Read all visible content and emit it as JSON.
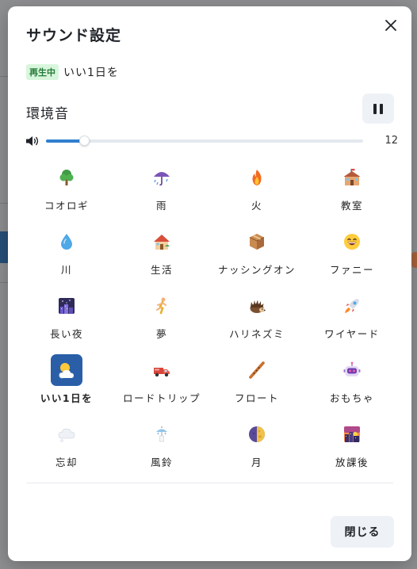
{
  "dialog": {
    "title": "サウンド設定",
    "close_icon": "close-icon"
  },
  "now_playing": {
    "badge": "再生中",
    "title": "いい1日を"
  },
  "ambient": {
    "section_title": "環境音",
    "pause_icon": "pause-icon",
    "volume_icon": "speaker-icon",
    "volume_value": "12",
    "volume_fraction": 0.12
  },
  "sounds": [
    {
      "label": "コオロギ",
      "icon": "tree-icon"
    },
    {
      "label": "雨",
      "icon": "umbrella-rain-icon"
    },
    {
      "label": "火",
      "icon": "fire-icon"
    },
    {
      "label": "教室",
      "icon": "school-icon"
    },
    {
      "label": "川",
      "icon": "droplet-icon"
    },
    {
      "label": "生活",
      "icon": "house-icon"
    },
    {
      "label": "ナッシングオン",
      "icon": "box-icon"
    },
    {
      "label": "ファニー",
      "icon": "grinning-face-icon"
    },
    {
      "label": "長い夜",
      "icon": "night-city-icon"
    },
    {
      "label": "夢",
      "icon": "running-person-icon"
    },
    {
      "label": "ハリネズミ",
      "icon": "hedgehog-icon"
    },
    {
      "label": "ワイヤード",
      "icon": "rocket-icon"
    },
    {
      "label": "いい1日を",
      "icon": "sun-cloud-icon",
      "selected": true
    },
    {
      "label": "ロードトリップ",
      "icon": "truck-icon"
    },
    {
      "label": "フロート",
      "icon": "flute-icon"
    },
    {
      "label": "おもちゃ",
      "icon": "robot-icon"
    },
    {
      "label": "忘却",
      "icon": "thought-bubble-icon"
    },
    {
      "label": "風鈴",
      "icon": "wind-chime-icon"
    },
    {
      "label": "月",
      "icon": "moon-icon"
    },
    {
      "label": "放課後",
      "icon": "city-sunset-icon"
    }
  ],
  "footer": {
    "close_label": "閉じる"
  },
  "colors": {
    "accent": "#2f7fcf",
    "selected_tile": "#2a5fa8",
    "badge_bg": "#d8f6dc",
    "badge_text": "#237a37"
  }
}
